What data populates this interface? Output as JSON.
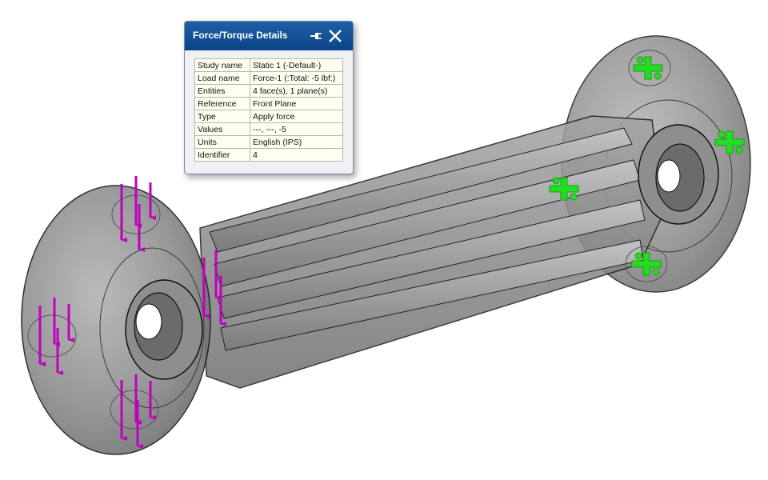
{
  "popup": {
    "title": "Force/Torque Details",
    "rows": [
      {
        "label": "Study name",
        "value": "Static 1 (-Default-)"
      },
      {
        "label": "Load name",
        "value": "Force-1 (:Total: -5 lbf:)"
      },
      {
        "label": "Entities",
        "value": "4 face(s), 1 plane(s)"
      },
      {
        "label": "Reference",
        "value": "Front Plane"
      },
      {
        "label": "Type",
        "value": "Apply force"
      },
      {
        "label": "Values",
        "value": "---, ---, -5"
      },
      {
        "label": "Units",
        "value": "English (IPS)"
      },
      {
        "label": "Identifier",
        "value": "4"
      }
    ],
    "pin_icon": "pin-icon",
    "close_icon": "close-icon"
  },
  "colors": {
    "title_bar": "#0b4486",
    "load_arrow": "#c000c0",
    "fixture": "#22dd22",
    "part": "#8a8a8a"
  }
}
